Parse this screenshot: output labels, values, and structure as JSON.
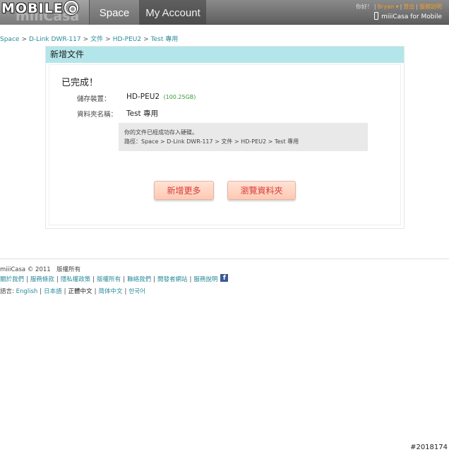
{
  "header": {
    "watermark_text": "MOBILE",
    "brand_text": "miiiCasa",
    "tabs": [
      {
        "label": "Space"
      },
      {
        "label": "My Account"
      }
    ],
    "greeting": "你好！",
    "username": "Bryan",
    "logout_label": "登出",
    "help_label": "服務說明",
    "mobile_label": "miiiCasa for Mobile"
  },
  "breadcrumb": [
    "Space",
    "D-Link DWR-117",
    "文件",
    "HD-PEU2",
    "Test 專用"
  ],
  "panel": {
    "title": "新增文件",
    "status": "已完成！",
    "device_label": "儲存裝置：",
    "device_value": "HD-PEU2",
    "device_size": "(100.25GB)",
    "folder_label": "資料夾名稱：",
    "folder_value": "Test 專用",
    "message_line1": "你的文件已經成功存入硬碟。",
    "message_line2": "路徑：Space > D-Link DWR-117 > 文件 > HD-PEU2 > Test 專用",
    "add_more_label": "新增更多",
    "browse_label": "瀏覽資料夾"
  },
  "footer": {
    "copyright": "miiiCasa © 2011　版權所有",
    "links": [
      "關於我們",
      "服務條款",
      "隱私權政策",
      "版權所有",
      "聯絡我們",
      "開發者網站",
      "服務說明"
    ],
    "language_label": "語言:",
    "languages": [
      "English",
      "日本語",
      "正體中文",
      "简体中文",
      "한국어"
    ],
    "current_language": "正體中文"
  },
  "photo_tag": "#2018174",
  "colors": {
    "panel_title_bg": "#b3e6ea",
    "link": "#2a8a9a",
    "user_link": "#f0a030",
    "button_text": "#d83a3a",
    "button_bg": "#ffc9b2",
    "size_note": "#3a9a3a",
    "facebook": "#3b5998"
  }
}
